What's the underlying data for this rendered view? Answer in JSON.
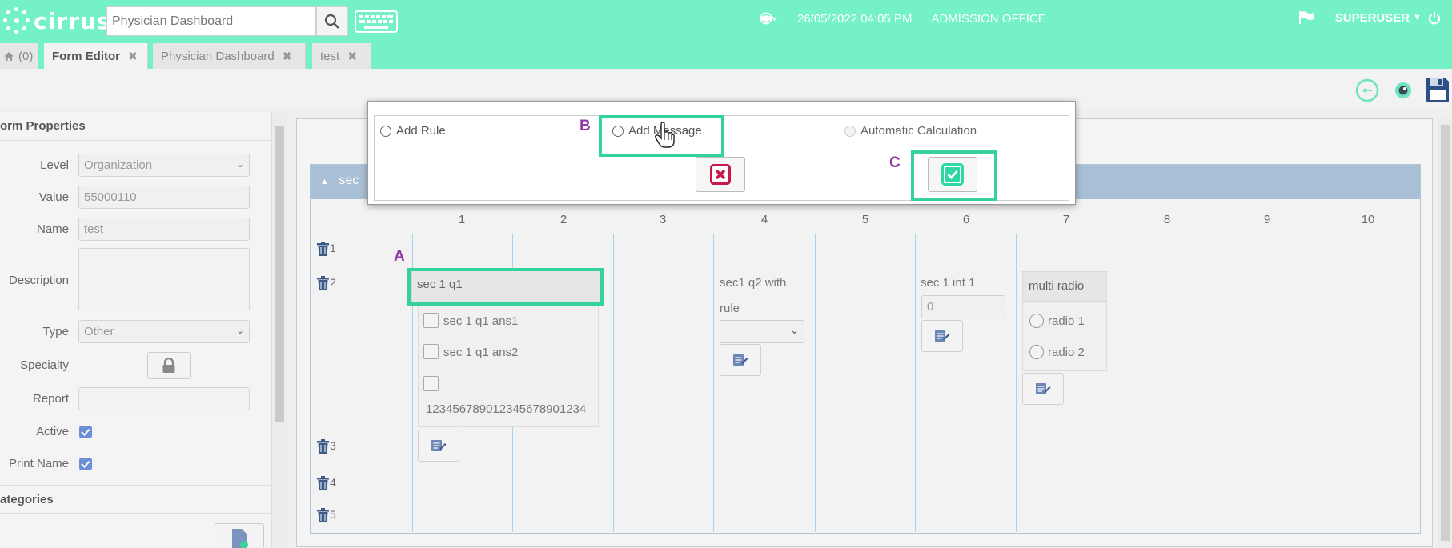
{
  "app": {
    "logo_text": "cirrus"
  },
  "header": {
    "search_value": "Physician Dashboard",
    "datetime": "26/05/2022 04:05 PM",
    "location": "ADMISSION OFFICE",
    "user": "SUPERUSER"
  },
  "tabs": [
    {
      "label": "(0)"
    },
    {
      "label": "Form Editor"
    },
    {
      "label": "Physician Dashboard"
    },
    {
      "label": "test"
    }
  ],
  "left_panel": {
    "title": "orm Properties",
    "fields": {
      "level_label": "Level",
      "level_value": "Organization",
      "value_label": "Value",
      "value_value": "55000110",
      "name_label": "Name",
      "name_value": "test",
      "description_label": "Description",
      "type_label": "Type",
      "type_value": "Other",
      "specialty_label": "Specialty",
      "report_label": "Report",
      "active_label": "Active",
      "print_name_label": "Print Name"
    },
    "categories_title": "ategories"
  },
  "section": {
    "title": "sec"
  },
  "grid": {
    "columns": [
      "1",
      "2",
      "3",
      "4",
      "5",
      "6",
      "7",
      "8",
      "9",
      "10"
    ],
    "rows": [
      "1",
      "2",
      "3",
      "4",
      "5"
    ]
  },
  "questions": {
    "q1": {
      "label": "sec 1 q1",
      "options": [
        "sec 1 q1 ans1",
        "sec 1 q1 ans2",
        "123456789012345678901234"
      ]
    },
    "q2": {
      "label_line1": "sec1 q2 with",
      "label_line2": "rule"
    },
    "int1": {
      "label": "sec 1 int 1",
      "value": "0"
    },
    "multi_radio": {
      "label": "multi radio",
      "options": [
        "radio 1",
        "radio 2"
      ]
    }
  },
  "dialog": {
    "option_add_rule": "Add Rule",
    "option_add_message": "Add Message",
    "option_auto_calc": "Automatic Calculation"
  },
  "annotations": {
    "a": "A",
    "b": "B",
    "c": "C"
  },
  "colors": {
    "header_bg": "#74f1c6",
    "highlight": "#34d39b",
    "annotation": "#8f3aa8",
    "cancel_red": "#c8184a",
    "confirm_teal": "#2fd7a6",
    "section_header": "#a9bfd6"
  }
}
